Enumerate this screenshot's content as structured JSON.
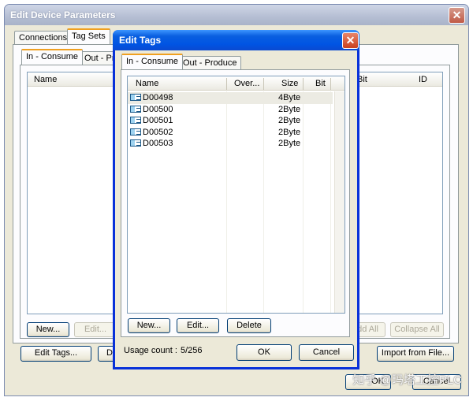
{
  "outer": {
    "title": "Edit Device Parameters",
    "tabs": [
      "Connections",
      "Tag Sets"
    ],
    "subtabs": [
      "In - Consume",
      "Out - Prod"
    ],
    "columns": {
      "name": "Name",
      "bit": "Bit",
      "id": "ID"
    },
    "buttons": {
      "new": "New...",
      "edit": "Edit...",
      "add_all": "Add All",
      "collapse_all": "Collapse All",
      "edit_tags": "Edit Tags...",
      "d": "D",
      "import": "Import from File...",
      "ok": "OK",
      "cancel": "Cancel"
    }
  },
  "inner": {
    "title": "Edit Tags",
    "tabs": [
      "In - Consume",
      "Out - Produce"
    ],
    "columns": {
      "name": "Name",
      "over": "Over...",
      "size": "Size",
      "bit": "Bit"
    },
    "rows": [
      {
        "name": "D00498",
        "size": "4Byte"
      },
      {
        "name": "D00500",
        "size": "2Byte"
      },
      {
        "name": "D00501",
        "size": "2Byte"
      },
      {
        "name": "D00502",
        "size": "2Byte"
      },
      {
        "name": "D00503",
        "size": "2Byte"
      }
    ],
    "buttons": {
      "new": "New...",
      "edit": "Edit...",
      "delete": "Delete",
      "ok": "OK",
      "cancel": "Cancel"
    },
    "usage_label": "Usage count :",
    "usage_value": "5/256"
  },
  "watermark": "知乎 @玛塔工控PLC"
}
